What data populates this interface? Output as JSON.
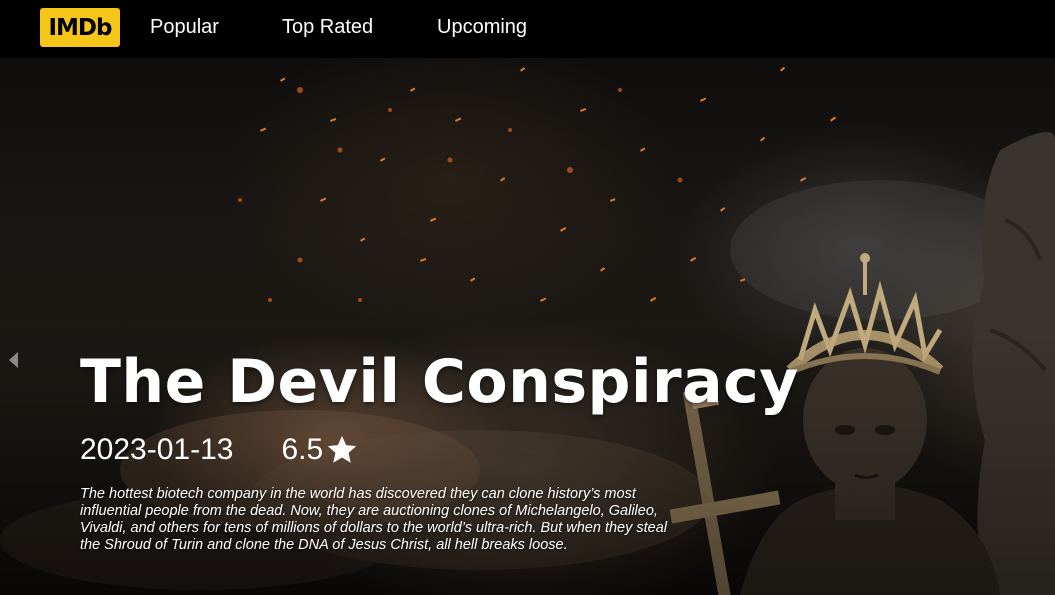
{
  "nav": {
    "logo_text": "IMDb",
    "links": [
      {
        "label": "Popular"
      },
      {
        "label": "Top Rated"
      },
      {
        "label": "Upcoming"
      }
    ]
  },
  "carousel": {
    "prev_icon": "chevron-left-icon",
    "movie": {
      "title": "The Devil Conspiracy",
      "release_date": "2023-01-13",
      "rating": "6.5",
      "rating_icon": "star-icon",
      "overview": "The hottest biotech company in the world has discovered they can clone history’s most influential people from the dead. Now, they are auctioning clones of Michelangelo, Galileo, Vivaldi, and others for tens of millions of dollars to the world’s ultra-rich. But when they steal the Shroud of Turin and clone the DNA of Jesus Christ, all hell breaks loose."
    }
  },
  "colors": {
    "logo_bg": "#f5c518",
    "nav_bg": "#000000",
    "text": "#ffffff"
  }
}
